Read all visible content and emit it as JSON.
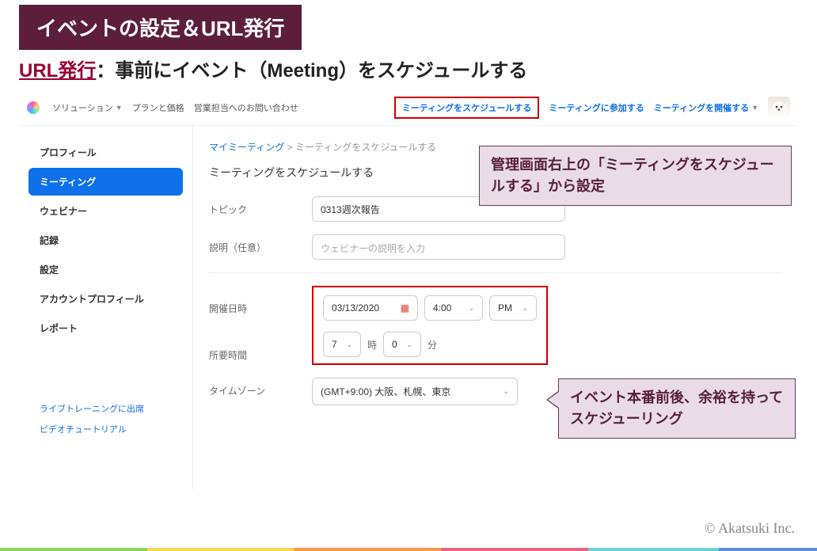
{
  "slide": {
    "title": "イベントの設定＆URL発行",
    "subtitle_underlined": "URL発行",
    "subtitle_rest": "：事前にイベント（Meeting）をスケジュールする"
  },
  "topnav": {
    "items": [
      {
        "label": "ソリューション",
        "dropdown": true
      },
      {
        "label": "プランと価格",
        "dropdown": false
      },
      {
        "label": "営業担当へのお問い合わせ",
        "dropdown": false
      }
    ],
    "right_links": [
      {
        "label": "ミーティングをスケジュールする",
        "boxed": true,
        "dropdown": false
      },
      {
        "label": "ミーティングに参加する",
        "boxed": false,
        "dropdown": false
      },
      {
        "label": "ミーティングを開催する",
        "boxed": false,
        "dropdown": true
      }
    ]
  },
  "sidebar": {
    "items": [
      {
        "label": "プロフィール",
        "active": false
      },
      {
        "label": "ミーティング",
        "active": true
      },
      {
        "label": "ウェビナー",
        "active": false
      },
      {
        "label": "記録",
        "active": false
      },
      {
        "label": "設定",
        "active": false
      },
      {
        "label": "アカウントプロフィール",
        "active": false
      },
      {
        "label": "レポート",
        "active": false
      }
    ],
    "sublinks": [
      "ライブトレーニングに出席",
      "ビデオチュートリアル"
    ]
  },
  "breadcrumb": {
    "parent": "マイミーティング",
    "sep": ">",
    "current": "ミーティングをスケジュールする"
  },
  "page_heading": "ミーティングをスケジュールする",
  "form": {
    "topic_label": "トピック",
    "topic_value": "0313週次報告",
    "desc_label": "説明（任意）",
    "desc_placeholder": "ウェビナーの説明を入力",
    "datetime_label": "開催日時",
    "date_value": "03/13/2020",
    "time_value": "4:00",
    "ampm_value": "PM",
    "duration_label": "所要時間",
    "duration_hours": "7",
    "duration_hours_unit": "時",
    "duration_minutes": "0",
    "duration_minutes_unit": "分",
    "timezone_label": "タイムゾーン",
    "timezone_value": "(GMT+9:00) 大阪、札幌、東京"
  },
  "callouts": {
    "c1": "管理画面右上の「ミーティングをスケジュールする」から設定",
    "c2": "イベント本番前後、余裕を持ってスケジューリング"
  },
  "footer": "© Akatsuki Inc."
}
